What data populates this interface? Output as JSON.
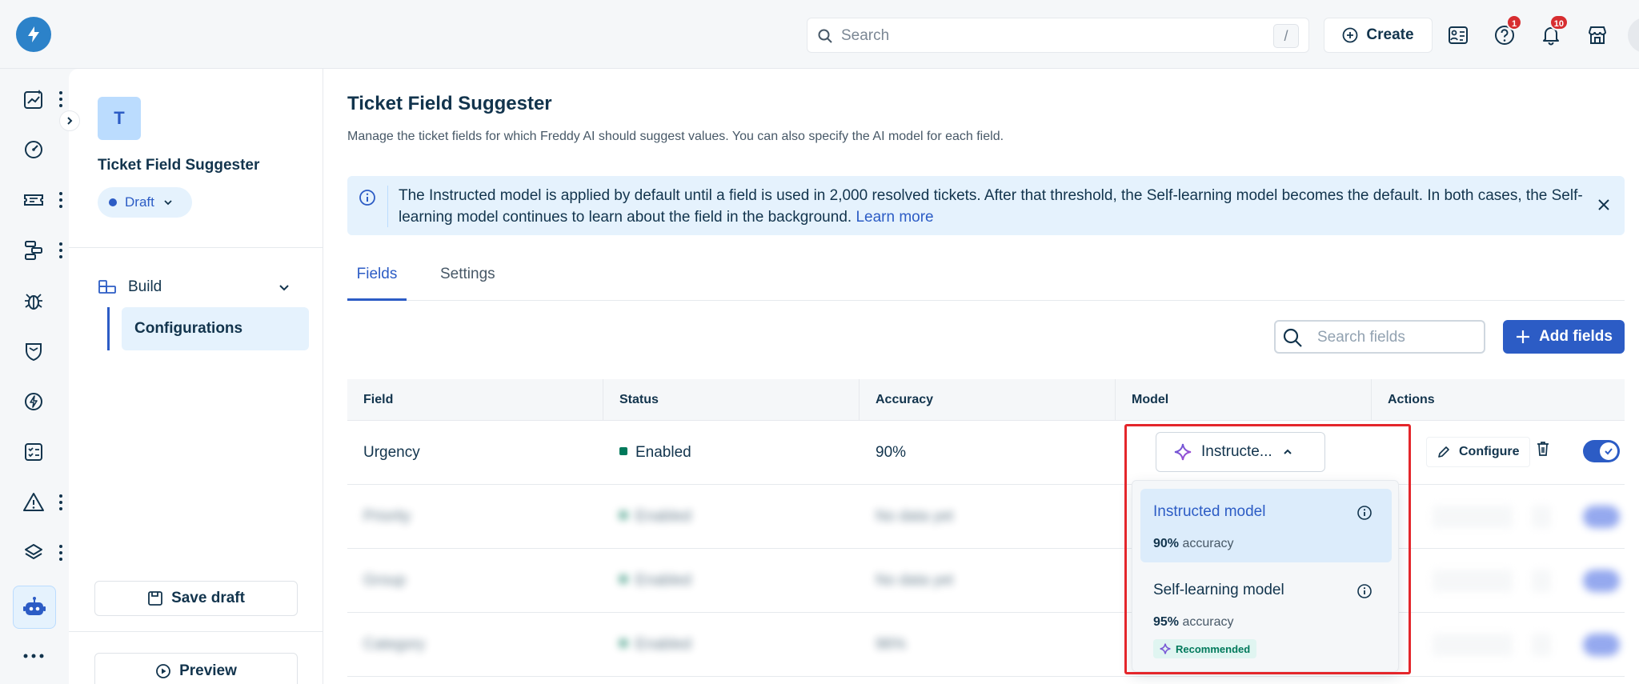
{
  "topbar": {
    "search_placeholder": "Search",
    "search_shortcut": "/",
    "create_label": "Create",
    "help_badge": "1",
    "notifications_badge": "10"
  },
  "panel": {
    "app_initial": "T",
    "app_name": "Ticket Field Suggester",
    "status": "Draft",
    "build_label": "Build",
    "nav_item": "Configurations",
    "save_draft": "Save draft",
    "preview": "Preview"
  },
  "main": {
    "title": "Ticket Field Suggester",
    "description": "Manage the ticket fields for which Freddy AI should suggest values. You can also specify the AI model for each field.",
    "banner_text": "The Instructed model is applied by default until a field is used in 2,000 resolved tickets. After that threshold, the Self-learning model becomes the default. In both cases, the Self-learning model continues to learn about the field in the background.",
    "banner_link": "Learn more",
    "tabs": [
      "Fields",
      "Settings"
    ],
    "search_placeholder": "Search fields",
    "add_fields": "Add fields"
  },
  "table": {
    "headers": [
      "Field",
      "Status",
      "Accuracy",
      "Model",
      "Actions"
    ],
    "rows": [
      {
        "field": "Urgency",
        "status": "Enabled",
        "accuracy": "90%",
        "model": "Instructe...",
        "configure": "Configure"
      },
      {
        "field": "Priority",
        "status": "Enabled",
        "accuracy": "No data yet"
      },
      {
        "field": "Group",
        "status": "Enabled",
        "accuracy": "No data yet"
      },
      {
        "field": "Category",
        "status": "Enabled",
        "accuracy": "96%"
      }
    ]
  },
  "dropdown": {
    "options": [
      {
        "name": "Instructed model",
        "accuracy_value": "90%",
        "accuracy_label": "accuracy"
      },
      {
        "name": "Self-learning model",
        "accuracy_value": "95%",
        "accuracy_label": "accuracy",
        "tag": "Recommended"
      }
    ]
  },
  "colors": {
    "primary": "#2c5cc5",
    "status_enabled": "#00795b",
    "highlight": "#e4262b",
    "badge": "#d72d30"
  }
}
